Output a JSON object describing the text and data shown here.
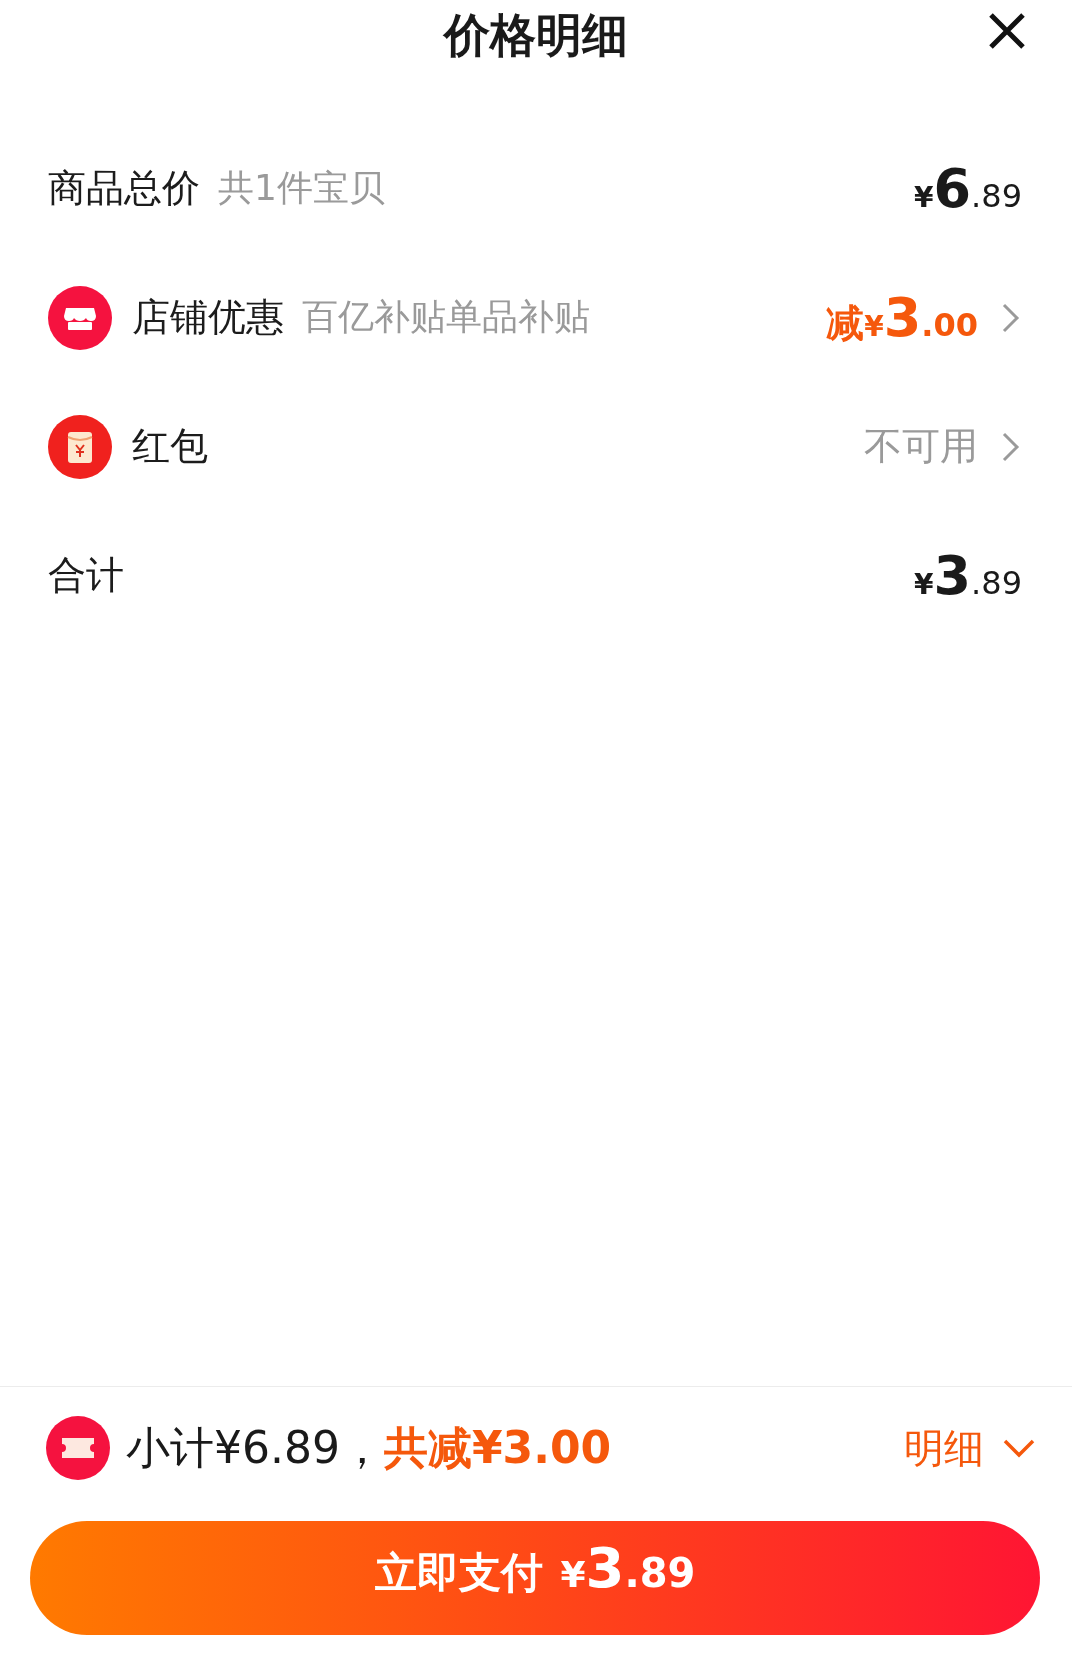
{
  "header": {
    "title": "价格明细"
  },
  "rows": [
    {
      "kind": "plain",
      "label": "商品总价",
      "note": "共1件宝贝",
      "amount": {
        "currency": "¥",
        "integer": "6",
        "decimal": ".89",
        "highlighted": false
      },
      "chevron": false
    },
    {
      "kind": "store",
      "label": "店铺优惠",
      "note": "百亿补贴单品补贴",
      "amount": {
        "prefix": "减",
        "currency": "¥",
        "integer": "3",
        "decimal": ".00",
        "highlighted": true
      },
      "chevron": true
    },
    {
      "kind": "redpacket",
      "label": "红包",
      "value": "不可用",
      "chevron": true
    },
    {
      "kind": "plain",
      "label": "合计",
      "amount": {
        "currency": "¥",
        "integer": "3",
        "decimal": ".89",
        "highlighted": false
      },
      "chevron": false
    }
  ],
  "summary": {
    "subtotal": "小计¥6.89，",
    "discount": "共减¥3.00",
    "details_button": "明细"
  },
  "pay_button": {
    "label": "立即支付",
    "currency": "¥",
    "integer": "3",
    "decimal": ".89"
  }
}
